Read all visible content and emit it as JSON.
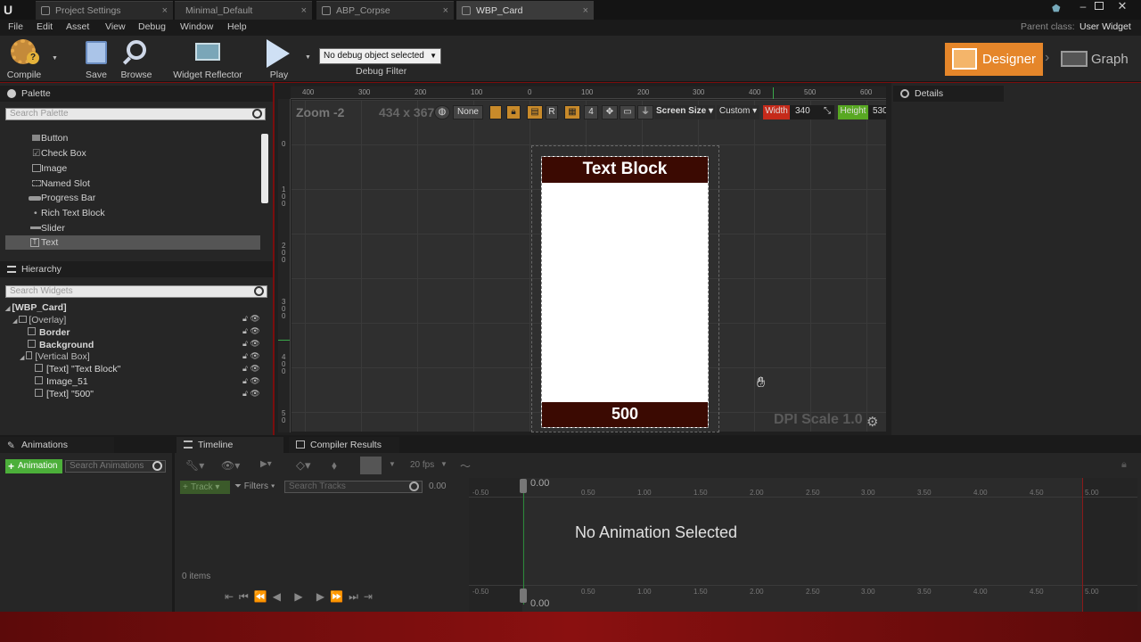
{
  "tabs": [
    {
      "label": "Project Settings",
      "active": false
    },
    {
      "label": "Minimal_Default",
      "active": false
    },
    {
      "label": "ABP_Corpse",
      "active": false
    },
    {
      "label": "WBP_Card",
      "active": true
    }
  ],
  "menu": [
    "File",
    "Edit",
    "Asset",
    "View",
    "Debug",
    "Window",
    "Help"
  ],
  "parent_class": {
    "label": "Parent class:",
    "value": "User Widget"
  },
  "toolbar": {
    "compile": "Compile",
    "save": "Save",
    "browse": "Browse",
    "widget_reflector": "Widget Reflector",
    "play": "Play",
    "debug_select": "No debug object selected",
    "debug_filter": "Debug Filter"
  },
  "modes": {
    "designer": "Designer",
    "graph": "Graph"
  },
  "palette": {
    "title": "Palette",
    "search_placeholder": "Search Palette",
    "items": [
      "Button",
      "Check Box",
      "Image",
      "Named Slot",
      "Progress Bar",
      "Rich Text Block",
      "Slider",
      "Text"
    ],
    "selected": "Text"
  },
  "hierarchy": {
    "title": "Hierarchy",
    "search_placeholder": "Search Widgets",
    "items": [
      "[WBP_Card]",
      "[Overlay]",
      "Border",
      "Background",
      "[Vertical Box]",
      "[Text] \"Text Block\"",
      "Image_51",
      "[Text] \"500\""
    ]
  },
  "designer": {
    "zoom": "Zoom -2",
    "size_readout": "434 x 367",
    "none_label": "None",
    "grid_snap": "4",
    "r_label": "R",
    "screen_size": "Screen Size",
    "custom": "Custom",
    "width_label": "Width",
    "width_value": "340",
    "height_label": "Height",
    "height_value": "530",
    "dpi": "DPI Scale 1.0",
    "ruler_h": [
      "400",
      "300",
      "200",
      "100",
      "0",
      "100",
      "200",
      "300",
      "400",
      "500",
      "600"
    ],
    "ruler_v": [
      "0",
      "1 0 0",
      "2 0 0",
      "3 0 0",
      "4 0 0",
      "5 0"
    ]
  },
  "card": {
    "title": "Text Block",
    "footer": "500",
    "header_color": "#3b0a02"
  },
  "details": {
    "title": "Details"
  },
  "animations": {
    "title": "Animations",
    "add_button": "Animation",
    "search_placeholder": "Search Animations"
  },
  "timeline": {
    "title": "Timeline",
    "compiler_tab": "Compiler Results",
    "fps": "20 fps",
    "track": "Track",
    "filters": "Filters",
    "search_placeholder": "Search Tracks",
    "time": "0.00",
    "items_count": "0 items",
    "empty": "No Animation Selected",
    "ticks": [
      "-0.50",
      "0.50",
      "1.00",
      "1.50",
      "2.00",
      "2.50",
      "3.00",
      "3.50",
      "4.00",
      "4.50",
      "5.00"
    ]
  },
  "colors": {
    "accent_orange": "#e5862a",
    "width_red": "#c52a1a",
    "height_green": "#58a822",
    "add_green": "#4caf3a"
  }
}
